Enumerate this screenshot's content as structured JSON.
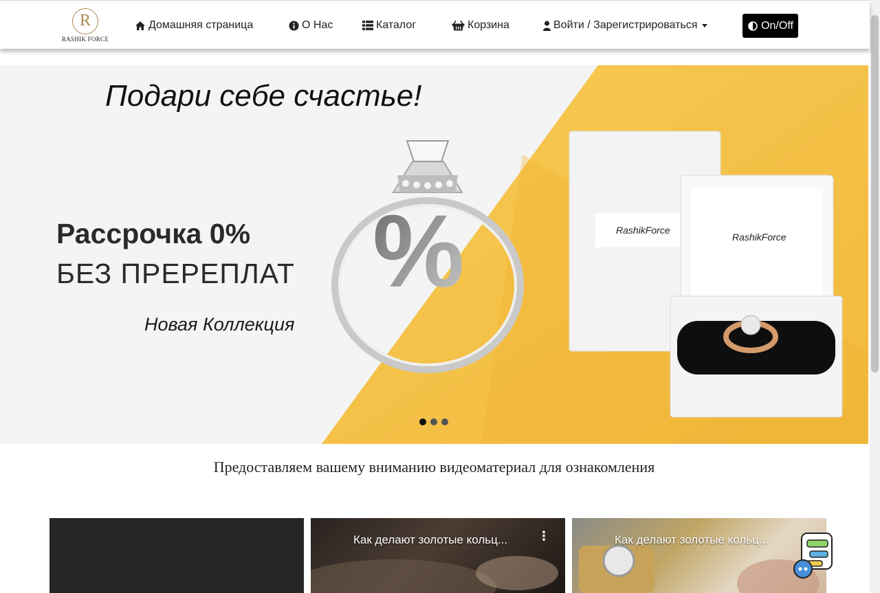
{
  "brand": {
    "logo_letter": "R",
    "logo_text": "RASHIK FORCE"
  },
  "nav": {
    "home": "Домашняя страница",
    "about": "О Нас",
    "catalog": "Каталог",
    "cart": "Корзина",
    "login": "Войти / Зарегистрироваться",
    "toggle": "On/Off"
  },
  "icons": {
    "home": "home-icon",
    "about": "info-circle-icon",
    "catalog": "list-icon",
    "cart": "shopping-basket-icon",
    "login": "user-icon",
    "toggle": "adjust-half-circle-icon"
  },
  "hero": {
    "title": "Подари себе счастье!",
    "line1": "Рассрочка 0%",
    "line2": "БЕЗ ПРЕРЕПЛАТ",
    "line3": "Новая Коллекция",
    "box_label_1": "RashikForce",
    "box_label_2": "RashikForce",
    "percent_sign": "%",
    "slides_total": 3,
    "active_slide": 1
  },
  "videos_section": {
    "heading": "Предоставляем вашему вниманию видеоматериал для ознакомления",
    "videos": [
      {
        "title": ""
      },
      {
        "title": "Как делают золотые кольц..."
      },
      {
        "title": "Как делают золотые кольц..."
      }
    ]
  },
  "colors": {
    "accent_gold": "#a98852",
    "banner_yellow": "#f5c242",
    "toggle_bg": "#000000"
  }
}
